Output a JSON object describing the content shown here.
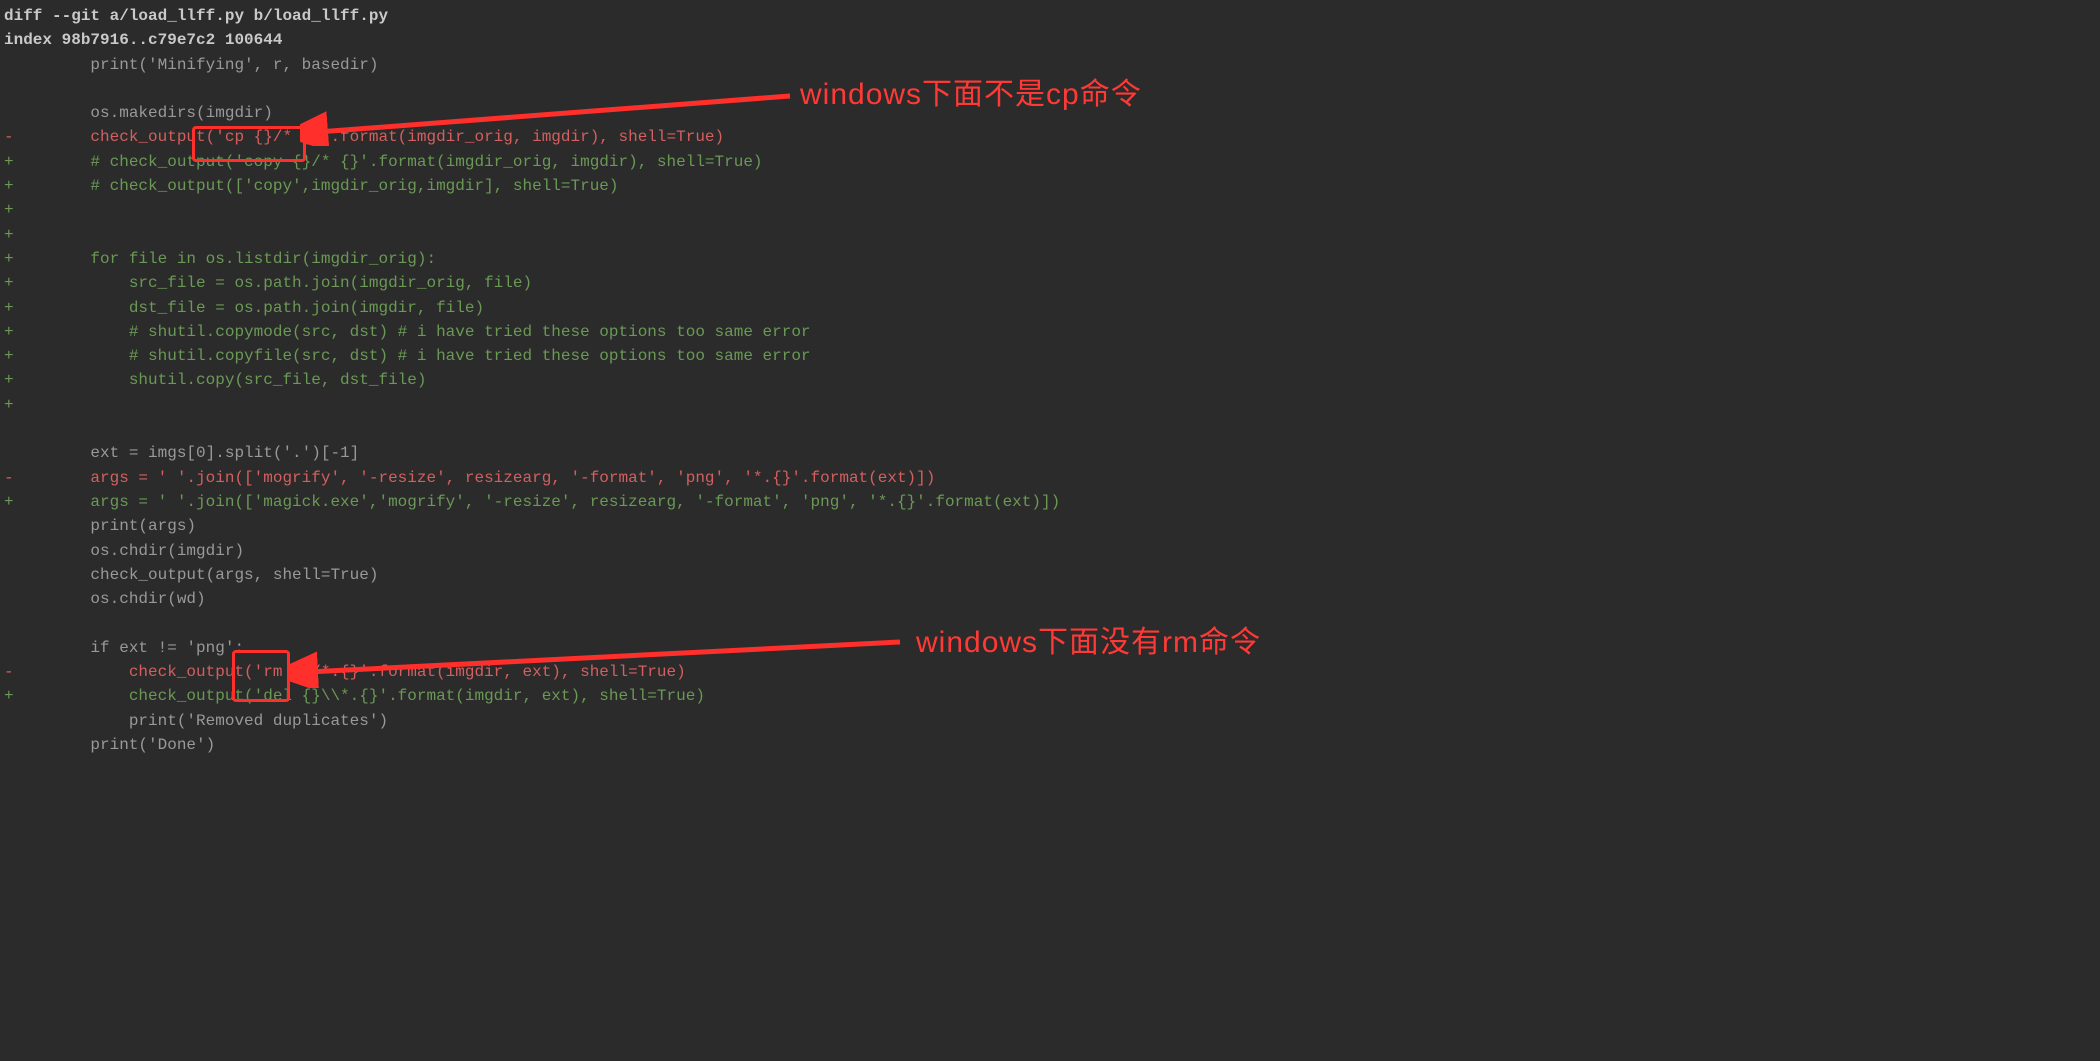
{
  "header": {
    "diff_line": "diff --git a/load_llff.py b/load_llff.py",
    "index_line": "index 98b7916..c79e7c2 100644"
  },
  "annotations": {
    "cp_note": "windows下面不是cp命令",
    "rm_note": "windows下面没有rm命令"
  },
  "diff": {
    "lines": [
      {
        "col": "ctxt",
        "t": "         print('Minifying', r, basedir)"
      },
      {
        "col": "ctxt",
        "t": " "
      },
      {
        "col": "ctxt",
        "t": "         os.makedirs(imgdir)"
      },
      {
        "col": "minus",
        "t": "-        check_output('cp {}/* {}'.format(imgdir_orig, imgdir), shell=True)"
      },
      {
        "col": "plus",
        "t": "+        # check_output('copy {}/* {}'.format(imgdir_orig, imgdir), shell=True)"
      },
      {
        "col": "plus",
        "t": "+        # check_output(['copy',imgdir_orig,imgdir], shell=True)"
      },
      {
        "col": "plus",
        "t": "+"
      },
      {
        "col": "plus",
        "t": "+"
      },
      {
        "col": "plus",
        "t": "+        for file in os.listdir(imgdir_orig):"
      },
      {
        "col": "plus",
        "t": "+            src_file = os.path.join(imgdir_orig, file)"
      },
      {
        "col": "plus",
        "t": "+            dst_file = os.path.join(imgdir, file)"
      },
      {
        "col": "plus",
        "t": "+            # shutil.copymode(src, dst) # i have tried these options too same error"
      },
      {
        "col": "plus",
        "t": "+            # shutil.copyfile(src, dst) # i have tried these options too same error"
      },
      {
        "col": "plus",
        "t": "+            shutil.copy(src_file, dst_file)"
      },
      {
        "col": "plus",
        "t": "+"
      },
      {
        "col": "ctxt",
        "t": " "
      },
      {
        "col": "ctxt",
        "t": "         ext = imgs[0].split('.')[-1]"
      },
      {
        "col": "minus",
        "t": "-        args = ' '.join(['mogrify', '-resize', resizearg, '-format', 'png', '*.{}'.format(ext)])"
      },
      {
        "col": "plus",
        "t": "+        args = ' '.join(['magick.exe','mogrify', '-resize', resizearg, '-format', 'png', '*.{}'.format(ext)])"
      },
      {
        "col": "ctxt",
        "t": "         print(args)"
      },
      {
        "col": "ctxt",
        "t": "         os.chdir(imgdir)"
      },
      {
        "col": "ctxt",
        "t": "         check_output(args, shell=True)"
      },
      {
        "col": "ctxt",
        "t": "         os.chdir(wd)"
      },
      {
        "col": "ctxt",
        "t": " "
      },
      {
        "col": "ctxt",
        "t": "         if ext != 'png':"
      },
      {
        "col": "minus",
        "t": "-            check_output('rm {}/*.{}'.format(imgdir, ext), shell=True)"
      },
      {
        "col": "plus",
        "t": "+            check_output('del {}\\\\*.{}'.format(imgdir, ext), shell=True)"
      },
      {
        "col": "ctxt",
        "t": "             print('Removed duplicates')"
      },
      {
        "col": "ctxt",
        "t": "         print('Done')"
      }
    ]
  }
}
